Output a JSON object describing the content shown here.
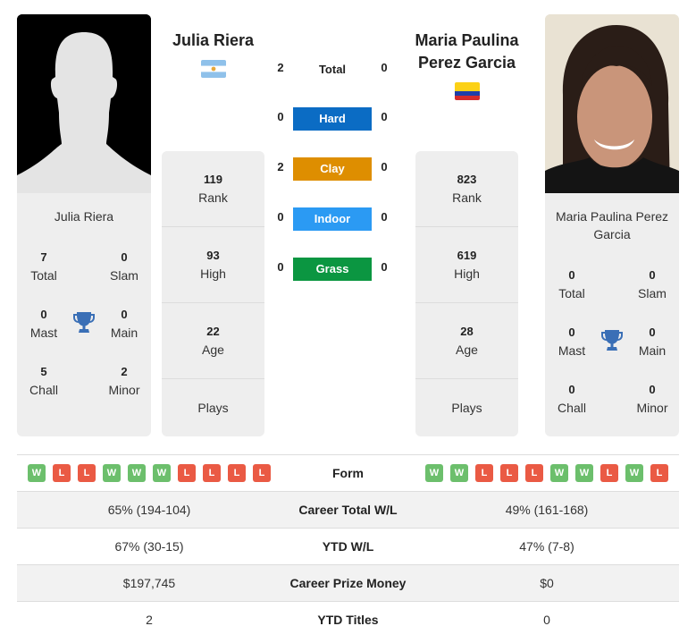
{
  "players": {
    "left": {
      "name": "Julia Riera",
      "card_name": "Julia Riera",
      "flag": "argentina-flag",
      "titles": {
        "total": {
          "value": "7",
          "label": "Total"
        },
        "slam": {
          "value": "0",
          "label": "Slam"
        },
        "mast": {
          "value": "0",
          "label": "Mast"
        },
        "main": {
          "value": "0",
          "label": "Main"
        },
        "chall": {
          "value": "5",
          "label": "Chall"
        },
        "minor": {
          "value": "2",
          "label": "Minor"
        }
      },
      "stats": {
        "rank": {
          "value": "119",
          "label": "Rank"
        },
        "high": {
          "value": "93",
          "label": "High"
        },
        "age": {
          "value": "22",
          "label": "Age"
        },
        "plays": {
          "value": "",
          "label": "Plays"
        }
      },
      "form": [
        "W",
        "L",
        "L",
        "W",
        "W",
        "W",
        "L",
        "L",
        "L",
        "L"
      ]
    },
    "right": {
      "name_line1": "Maria Paulina",
      "name_line2": "Perez Garcia",
      "card_name_line1": "Maria Paulina Perez",
      "card_name_line2": "Garcia",
      "flag": "colombia-flag",
      "titles": {
        "total": {
          "value": "0",
          "label": "Total"
        },
        "slam": {
          "value": "0",
          "label": "Slam"
        },
        "mast": {
          "value": "0",
          "label": "Mast"
        },
        "main": {
          "value": "0",
          "label": "Main"
        },
        "chall": {
          "value": "0",
          "label": "Chall"
        },
        "minor": {
          "value": "0",
          "label": "Minor"
        }
      },
      "stats": {
        "rank": {
          "value": "823",
          "label": "Rank"
        },
        "high": {
          "value": "619",
          "label": "High"
        },
        "age": {
          "value": "28",
          "label": "Age"
        },
        "plays": {
          "value": "",
          "label": "Plays"
        }
      },
      "form": [
        "W",
        "W",
        "L",
        "L",
        "L",
        "W",
        "W",
        "L",
        "W",
        "L"
      ]
    }
  },
  "h2h": {
    "total": {
      "label": "Total",
      "left": "2",
      "right": "0"
    },
    "surfaces": [
      {
        "label": "Hard",
        "left": "0",
        "right": "0",
        "color": "#0b6cc4"
      },
      {
        "label": "Clay",
        "left": "2",
        "right": "0",
        "color": "#de8e00"
      },
      {
        "label": "Indoor",
        "left": "0",
        "right": "0",
        "color": "#2b9af3"
      },
      {
        "label": "Grass",
        "left": "0",
        "right": "0",
        "color": "#0b9641"
      }
    ]
  },
  "table": {
    "form_label": "Form",
    "rows": [
      {
        "label": "Career Total W/L",
        "left": "65% (194-104)",
        "right": "49% (161-168)"
      },
      {
        "label": "YTD W/L",
        "left": "67% (30-15)",
        "right": "47% (7-8)"
      },
      {
        "label": "Career Prize Money",
        "left": "$197,745",
        "right": "$0"
      },
      {
        "label": "YTD Titles",
        "left": "2",
        "right": "0"
      }
    ]
  }
}
